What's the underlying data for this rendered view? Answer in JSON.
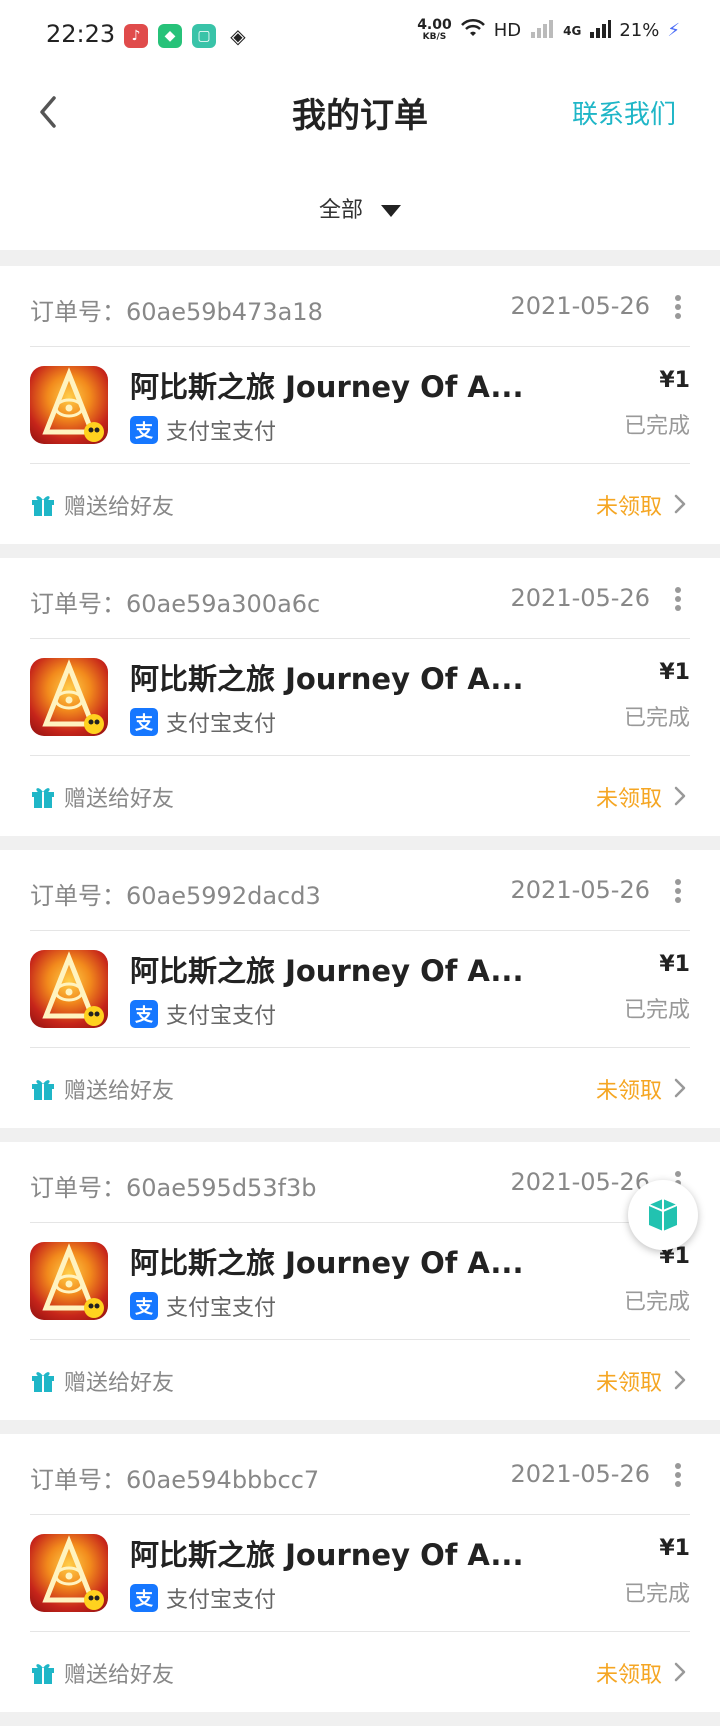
{
  "status_bar": {
    "time": "22:23",
    "net_speed_value": "4.00",
    "net_speed_unit": "KB/S",
    "network_label": "HD",
    "signal_label": "4G",
    "battery": "21%"
  },
  "header": {
    "title": "我的订单",
    "contact_label": "联系我们"
  },
  "filter": {
    "selected": "全部"
  },
  "orders": [
    {
      "id_label": "订单号：60ae59b473a18",
      "date": "2021-05-26",
      "game_name": "阿比斯之旅 Journey Of A...",
      "payment": "支付宝支付",
      "price": "¥1",
      "status": "已完成",
      "gift_label": "赠送给好友",
      "claim_status": "未领取"
    },
    {
      "id_label": "订单号：60ae59a300a6c",
      "date": "2021-05-26",
      "game_name": "阿比斯之旅 Journey Of A...",
      "payment": "支付宝支付",
      "price": "¥1",
      "status": "已完成",
      "gift_label": "赠送给好友",
      "claim_status": "未领取"
    },
    {
      "id_label": "订单号：60ae5992dacd3",
      "date": "2021-05-26",
      "game_name": "阿比斯之旅 Journey Of A...",
      "payment": "支付宝支付",
      "price": "¥1",
      "status": "已完成",
      "gift_label": "赠送给好友",
      "claim_status": "未领取"
    },
    {
      "id_label": "订单号：60ae595d53f3b",
      "date": "2021-05-26",
      "game_name": "阿比斯之旅 Journey Of A...",
      "payment": "支付宝支付",
      "price": "¥1",
      "status": "已完成",
      "gift_label": "赠送给好友",
      "claim_status": "未领取"
    },
    {
      "id_label": "订单号：60ae594bbbcc7",
      "date": "2021-05-26",
      "game_name": "阿比斯之旅 Journey Of A...",
      "payment": "支付宝支付",
      "price": "¥1",
      "status": "已完成",
      "gift_label": "赠送给好友",
      "claim_status": "未领取"
    }
  ],
  "colors": {
    "accent": "#1fb6c7",
    "claim": "#f5a623",
    "alipay": "#1677ff"
  },
  "icons": {
    "back": "chevron-left-icon",
    "filter_caret": "caret-down-icon",
    "more": "more-vertical-icon",
    "gift": "gift-icon",
    "alipay": "alipay-icon",
    "floating": "cube-icon"
  }
}
